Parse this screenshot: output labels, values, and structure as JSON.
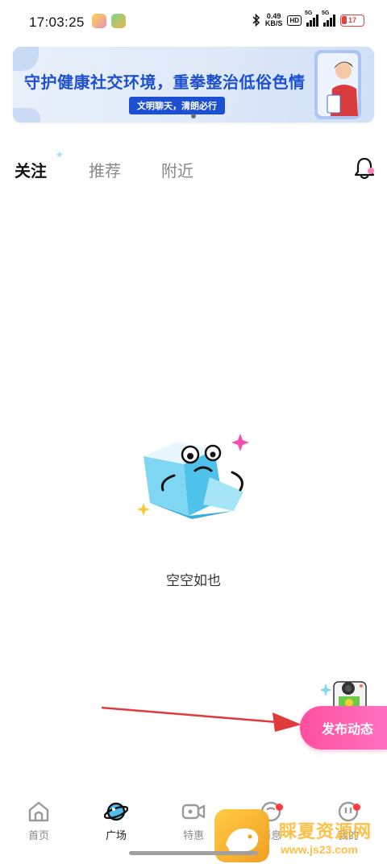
{
  "status_bar": {
    "time": "17:03:25",
    "net_speed_value": "0.49",
    "net_speed_unit": "KB/S",
    "hd_label": "HD",
    "signal_label_1": "5G",
    "signal_label_2": "5G",
    "battery_level": "17",
    "battery_color": "#e0453d"
  },
  "banner": {
    "title": "守护健康社交环境，重拳整治低俗色情",
    "subtitle": "文明聊天，清朗必行",
    "title_color": "#1d4fd1"
  },
  "tabs": [
    {
      "label": "关注",
      "active": true
    },
    {
      "label": "推荐",
      "active": false
    },
    {
      "label": "附近",
      "active": false
    }
  ],
  "header_icon": "bell-icon",
  "empty_state": {
    "text": "空空如也",
    "illustration": "sad-ice-cube-character"
  },
  "fab": {
    "label": "发布动态",
    "icon": "camera-icon",
    "color": "#ff4f9f"
  },
  "annotation_arrow_color": "#e03a3a",
  "bottom_nav": [
    {
      "label": "首页",
      "icon": "home-icon",
      "active": false,
      "badge": false
    },
    {
      "label": "广场",
      "icon": "planet-icon",
      "active": true,
      "badge": false
    },
    {
      "label": "特惠",
      "icon": "video-camera-icon",
      "active": false,
      "badge": false
    },
    {
      "label": "消息",
      "icon": "chat-icon",
      "active": false,
      "badge": true
    },
    {
      "label": "我的",
      "icon": "profile-icon",
      "active": false,
      "badge": true
    }
  ],
  "watermark": {
    "text": "睬夏资源网",
    "url": "www.js23.com"
  }
}
